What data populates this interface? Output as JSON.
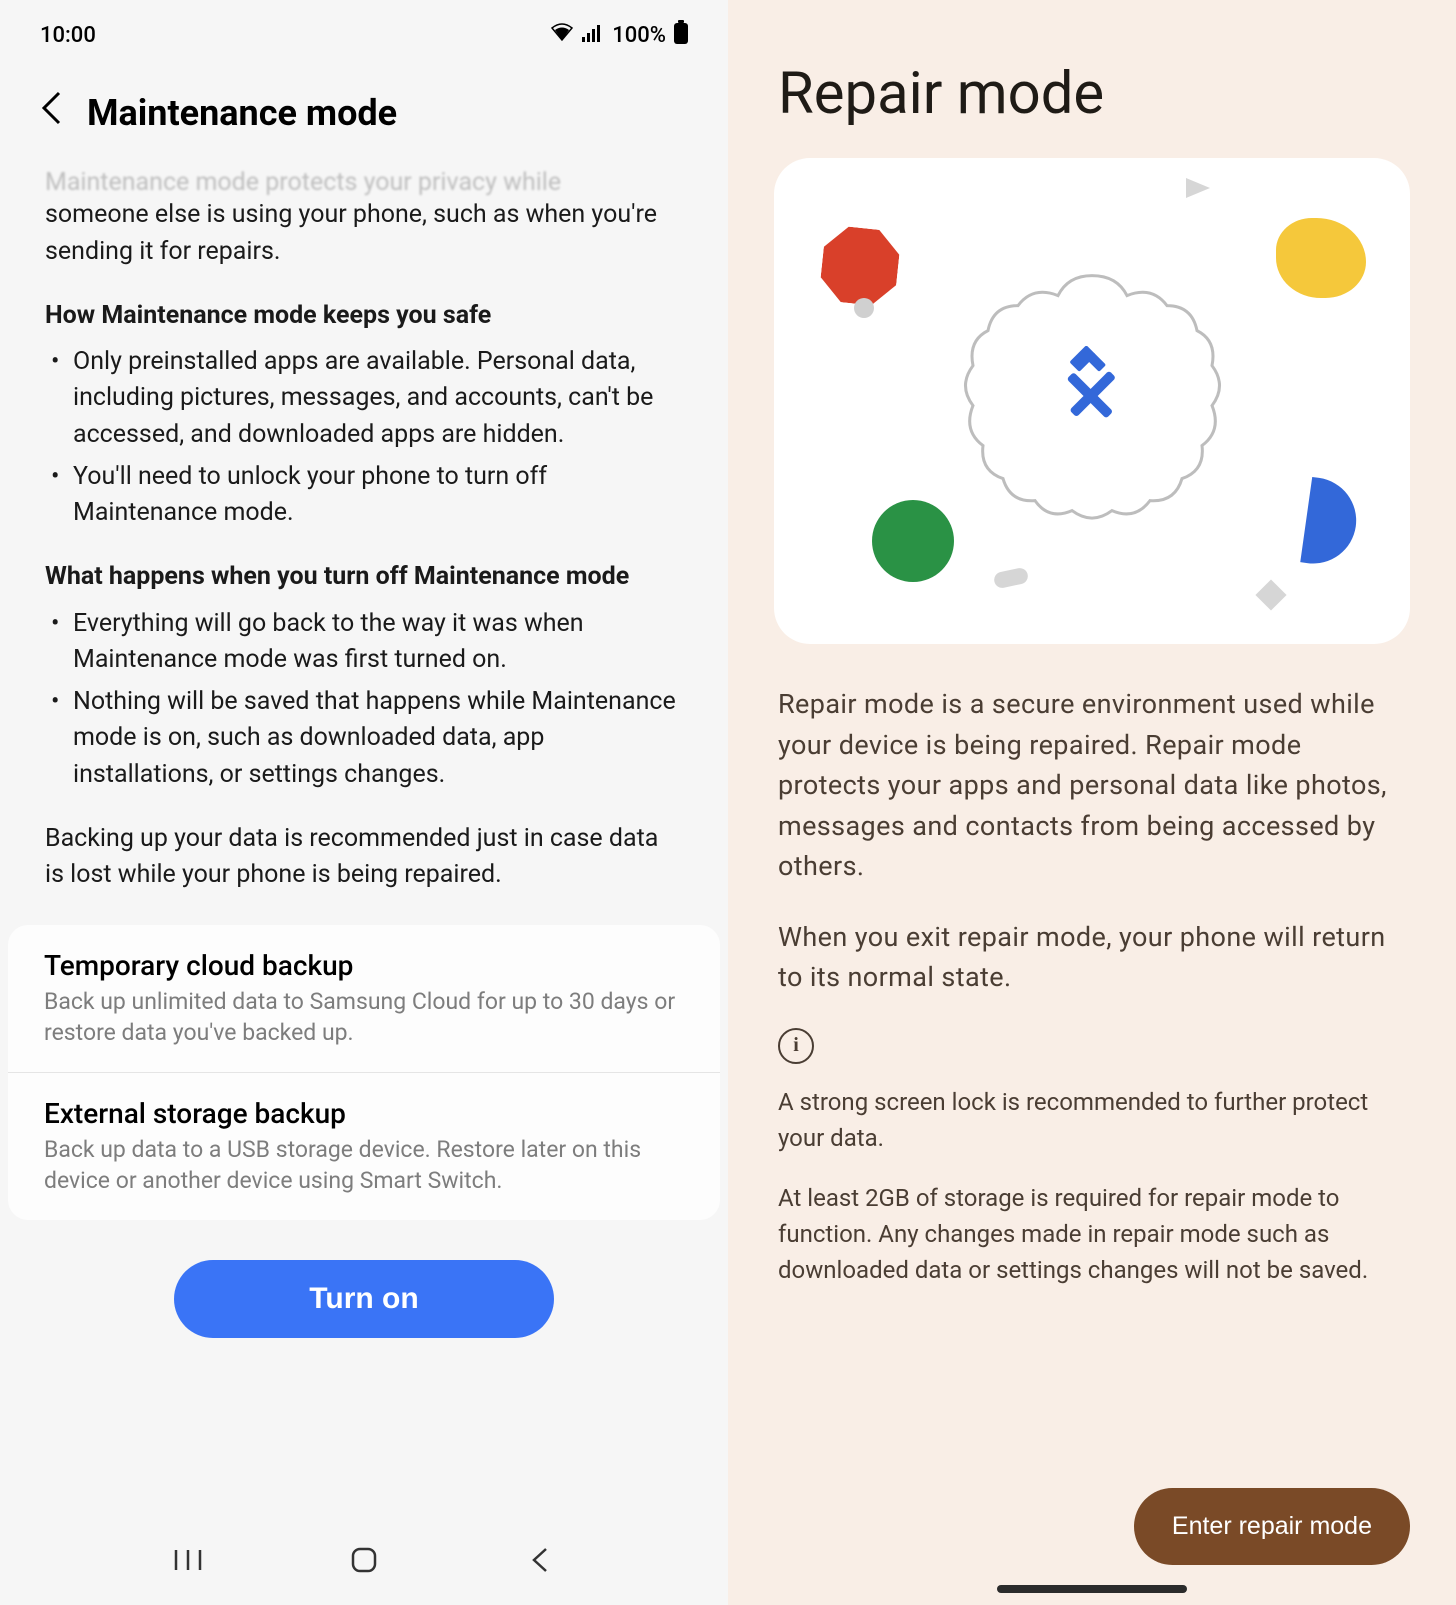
{
  "left": {
    "status": {
      "time": "10:00",
      "battery": "100%"
    },
    "title": "Maintenance mode",
    "intro_cut": "Maintenance mode protects your privacy while",
    "intro_rest": "someone else is using your phone, such as when you're sending it for repairs.",
    "section1_h": "How Maintenance mode keeps you safe",
    "bullets1": [
      "Only preinstalled apps are available. Personal data, including pictures, messages, and accounts, can't be accessed, and downloaded apps are hidden.",
      "You'll need to unlock your phone to turn off Maintenance mode."
    ],
    "section2_h": "What happens when you turn off Maintenance mode",
    "bullets2": [
      "Everything will go back to the way it was when Maintenance mode was first turned on.",
      "Nothing will be saved that happens while Maintenance mode is on, such as downloaded data, app installations, or settings changes."
    ],
    "note": "Backing up your data is recommended just in case data is lost while your phone is being repaired.",
    "options": [
      {
        "title": "Temporary cloud backup",
        "desc": "Back up unlimited data to Samsung Cloud for up to 30 days or restore data you've backed up."
      },
      {
        "title": "External storage backup",
        "desc": "Back up data to a USB storage device. Restore later on this device or another device using Smart Switch."
      }
    ],
    "button": "Turn on"
  },
  "right": {
    "title": "Repair mode",
    "desc1": "Repair mode is a secure environment used while your device is being repaired. Repair mode protects your apps and personal data like photos, messages and contacts from being accessed by others.",
    "desc2": "When you exit repair mode, your phone will return to its normal state.",
    "note1": "A strong screen lock is recommended to further protect your data.",
    "note2": "At least 2GB of storage is required for repair mode to function. Any changes made in repair mode such as downloaded data or settings changes will not be saved.",
    "button": "Enter repair mode"
  }
}
